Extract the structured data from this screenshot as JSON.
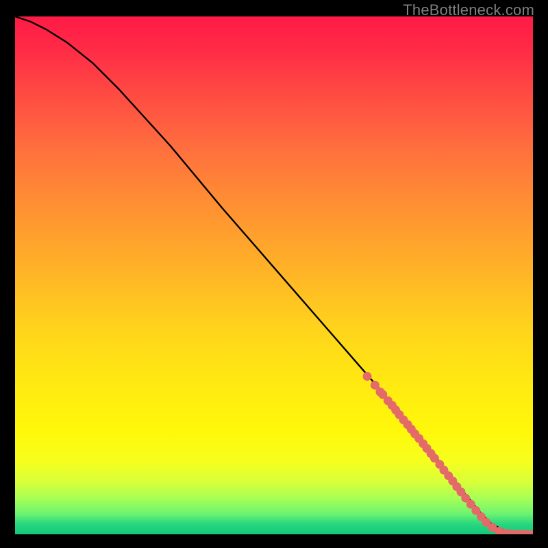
{
  "watermark": "TheBottleneck.com",
  "colors": {
    "page_bg": "#000000",
    "watermark": "#7f7f7f",
    "curve": "#000000",
    "marker_fill": "#e46a6a",
    "marker_stroke": "#c84d4d",
    "gradient_top": "#ff1a46",
    "gradient_bottom": "#11c97a"
  },
  "chart_data": {
    "type": "line",
    "title": "",
    "xlabel": "",
    "ylabel": "",
    "xlim": [
      0,
      100
    ],
    "ylim": [
      0,
      100
    ],
    "series": [
      {
        "name": "curve",
        "x": [
          0,
          3,
          6,
          10,
          15,
          20,
          30,
          40,
          50,
          60,
          70,
          78,
          82,
          85,
          88,
          90,
          92,
          95,
          98,
          100
        ],
        "y": [
          100,
          99,
          97.5,
          95,
          91,
          86,
          75,
          63,
          51.5,
          40,
          28.5,
          19,
          14,
          10,
          6.5,
          4,
          2,
          0.5,
          0,
          0
        ]
      }
    ],
    "markers": {
      "name": "highlighted-points",
      "x": [
        68,
        69.5,
        70.5,
        71,
        72,
        72.8,
        73.5,
        74.2,
        75,
        75.8,
        76.5,
        77.2,
        78,
        78.8,
        79.5,
        80.3,
        81,
        82,
        82.8,
        83.7,
        84.5,
        85.3,
        86.1,
        87,
        88,
        89,
        90,
        91,
        92.2,
        93.5,
        94.7,
        95.8,
        96.8,
        97.7,
        98.8,
        100
      ],
      "y": [
        30.5,
        28.8,
        27.5,
        27,
        25.8,
        24.9,
        24,
        23.1,
        22.1,
        21.2,
        20.3,
        19.4,
        18.5,
        17.5,
        16.6,
        15.6,
        14.7,
        13.5,
        12.4,
        11.3,
        10.3,
        9.2,
        8.2,
        7.0,
        5.8,
        4.6,
        3.4,
        2.3,
        1.3,
        0.6,
        0.2,
        0.05,
        0,
        0,
        0,
        0
      ]
    }
  }
}
